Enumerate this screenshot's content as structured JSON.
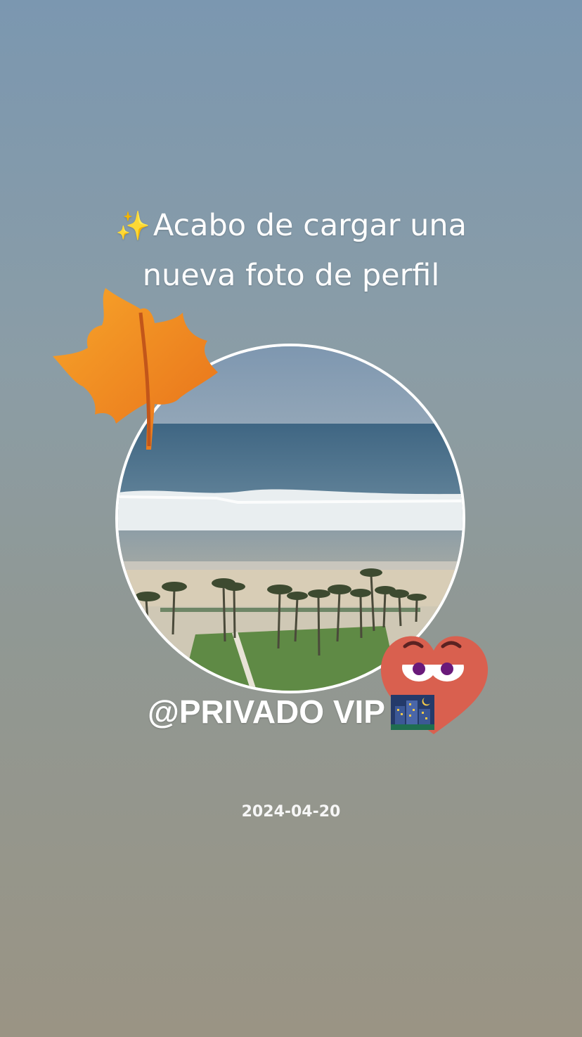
{
  "post": {
    "headline_line1": "Acabo de cargar una",
    "headline_line2": "nueva foto de perfil",
    "username": "@PRIVADO VIP",
    "date": "2024-04-20"
  },
  "stickers": {
    "sparkle": "sparkles-icon",
    "leaf": "maple-leaf-icon",
    "heart": "heart-face-icon",
    "city": "night-city-icon"
  },
  "colors": {
    "text": "#ffffff",
    "leaf_orange": "#f28a1c",
    "heart_red": "#d9604f",
    "background_top": "#7b97b0",
    "background_bottom": "#9a9484"
  }
}
